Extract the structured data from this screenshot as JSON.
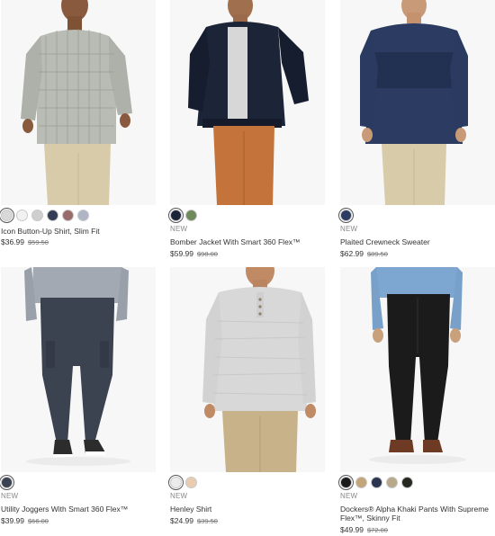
{
  "products": [
    {
      "name": "Icon Button-Up Shirt, Slim Fit",
      "badge": "",
      "price": "$36.99",
      "original_price": "$59.50",
      "image_icon": "plaid-shirt-model",
      "swatch_colors": [
        "#d9d9d9",
        "#f1f1f1",
        "#cfcfcf",
        "#333d55",
        "#9a6b6b",
        "#aeb5c4"
      ],
      "selected_swatch": 0
    },
    {
      "name": "Bomber Jacket With Smart 360 Flex™",
      "badge": "NEW",
      "price": "$59.99",
      "original_price": "$98.00",
      "image_icon": "bomber-jacket-model",
      "swatch_colors": [
        "#1c2438",
        "#6f8a5a"
      ],
      "selected_swatch": 0
    },
    {
      "name": "Plaited Crewneck Sweater",
      "badge": "NEW",
      "price": "$62.99",
      "original_price": "$89.50",
      "image_icon": "crewneck-sweater-model",
      "swatch_colors": [
        "#2c3b62"
      ],
      "selected_swatch": 0
    },
    {
      "name": "Utility Joggers With Smart 360 Flex™",
      "badge": "NEW",
      "price": "$39.99",
      "original_price": "$66.00",
      "image_icon": "joggers-model",
      "swatch_colors": [
        "#3b4250"
      ],
      "selected_swatch": 0
    },
    {
      "name": "Henley Shirt",
      "badge": "NEW",
      "price": "$24.99",
      "original_price": "$39.50",
      "image_icon": "henley-shirt-model",
      "swatch_colors": [
        "#ececec",
        "#e8cbb1"
      ],
      "selected_swatch": 0
    },
    {
      "name": "Dockers® Alpha Khaki Pants With Supreme Flex™, Skinny Fit",
      "badge": "NEW",
      "price": "$49.99",
      "original_price": "$72.00",
      "image_icon": "khaki-pants-model",
      "swatch_colors": [
        "#1b1b1b",
        "#c3a57a",
        "#2b3552",
        "#b7a98a",
        "#25291f"
      ],
      "selected_swatch": 0
    }
  ]
}
